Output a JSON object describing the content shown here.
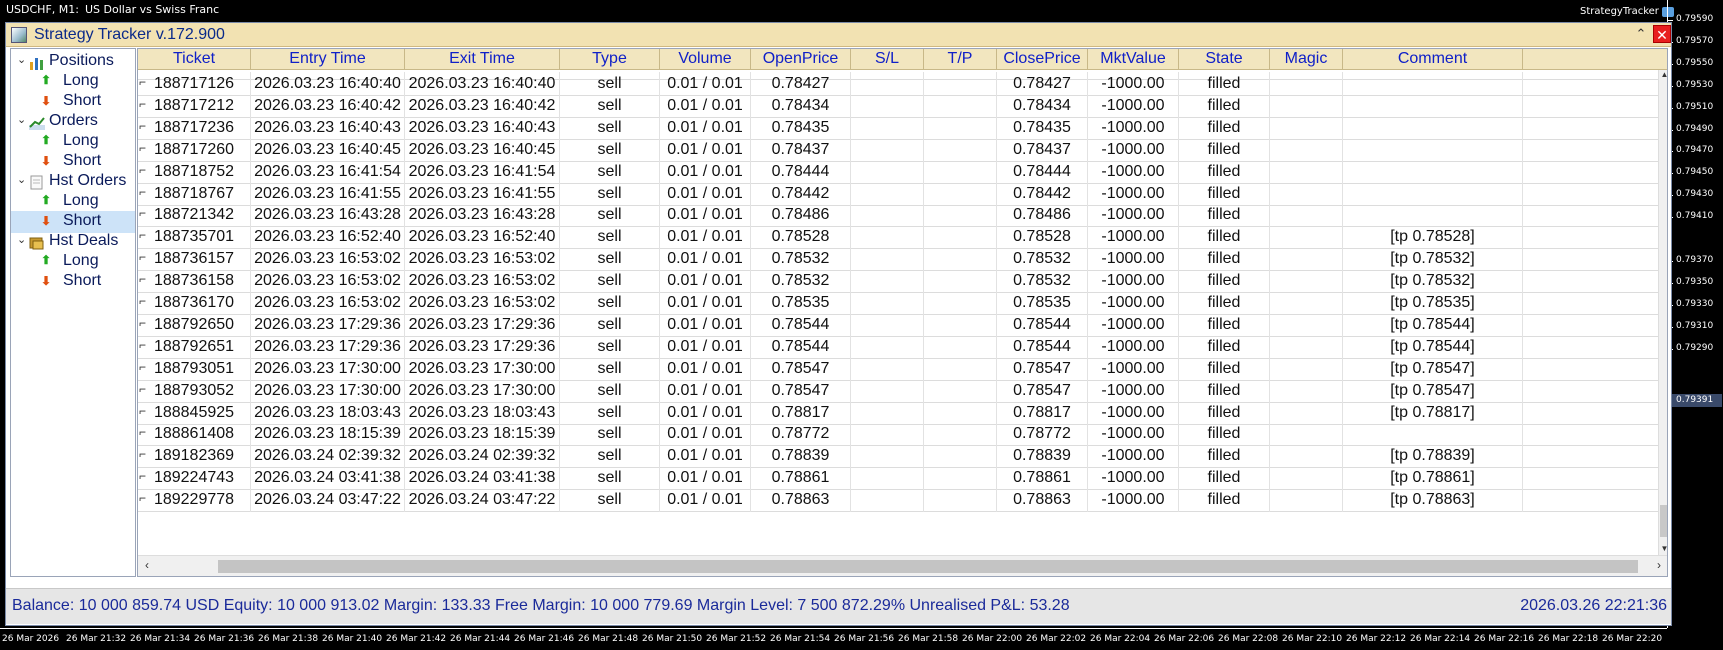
{
  "chart": {
    "symbol": "USDCHF, M1:",
    "description": "US Dollar vs Swiss Franc",
    "badge": "StrategyTracker",
    "price_labels": [
      "0.79590",
      "0.79570",
      "0.79550",
      "0.79530",
      "0.79510",
      "0.79490",
      "0.79470",
      "0.79450",
      "0.79430",
      "0.79410",
      "0.79370",
      "0.79350",
      "0.79330",
      "0.79310",
      "0.79290"
    ],
    "current_price": "0.79391",
    "time_labels": [
      "26 Mar 2026",
      "26 Mar 21:32",
      "26 Mar 21:34",
      "26 Mar 21:36",
      "26 Mar 21:38",
      "26 Mar 21:40",
      "26 Mar 21:42",
      "26 Mar 21:44",
      "26 Mar 21:46",
      "26 Mar 21:48",
      "26 Mar 21:50",
      "26 Mar 21:52",
      "26 Mar 21:54",
      "26 Mar 21:56",
      "26 Mar 21:58",
      "26 Mar 22:00",
      "26 Mar 22:02",
      "26 Mar 22:04",
      "26 Mar 22:06",
      "26 Mar 22:08",
      "26 Mar 22:10",
      "26 Mar 22:12",
      "26 Mar 22:14",
      "26 Mar 22:16",
      "26 Mar 22:18",
      "26 Mar 22:20"
    ]
  },
  "window": {
    "title": "Strategy Tracker v.172.900",
    "collapse_glyph": "⌃",
    "close_glyph": "✕"
  },
  "tree": [
    {
      "label": "Positions",
      "level": 0,
      "icon": "bar-chart-icon",
      "expanded": true
    },
    {
      "label": "Long",
      "level": 1,
      "icon": "arrow-up-icon"
    },
    {
      "label": "Short",
      "level": 1,
      "icon": "arrow-down-icon"
    },
    {
      "label": "Orders",
      "level": 0,
      "icon": "line-chart-icon",
      "expanded": true
    },
    {
      "label": "Long",
      "level": 1,
      "icon": "arrow-up-icon"
    },
    {
      "label": "Short",
      "level": 1,
      "icon": "arrow-down-icon"
    },
    {
      "label": "Hst Orders",
      "level": 0,
      "icon": "document-icon",
      "expanded": true
    },
    {
      "label": "Long",
      "level": 1,
      "icon": "arrow-up-icon"
    },
    {
      "label": "Short",
      "level": 1,
      "icon": "arrow-down-icon",
      "selected": true
    },
    {
      "label": "Hst Deals",
      "level": 0,
      "icon": "coins-icon",
      "expanded": true
    },
    {
      "label": "Long",
      "level": 1,
      "icon": "arrow-up-icon"
    },
    {
      "label": "Short",
      "level": 1,
      "icon": "arrow-down-icon"
    }
  ],
  "columns": [
    "Ticket",
    "Entry Time",
    "Exit Time",
    "Type",
    "Volume",
    "OpenPrice",
    "S/L",
    "T/P",
    "ClosePrice",
    "MktValue",
    "State",
    "Magic",
    "Comment"
  ],
  "rows": [
    [
      "188717126",
      "2026.03.23 16:40:40",
      "2026.03.23 16:40:40",
      "sell",
      "0.01 / 0.01",
      "0.78427",
      "",
      "",
      "0.78427",
      "-1000.00",
      "filled",
      "",
      ""
    ],
    [
      "188717212",
      "2026.03.23 16:40:42",
      "2026.03.23 16:40:42",
      "sell",
      "0.01 / 0.01",
      "0.78434",
      "",
      "",
      "0.78434",
      "-1000.00",
      "filled",
      "",
      ""
    ],
    [
      "188717236",
      "2026.03.23 16:40:43",
      "2026.03.23 16:40:43",
      "sell",
      "0.01 / 0.01",
      "0.78435",
      "",
      "",
      "0.78435",
      "-1000.00",
      "filled",
      "",
      ""
    ],
    [
      "188717260",
      "2026.03.23 16:40:45",
      "2026.03.23 16:40:45",
      "sell",
      "0.01 / 0.01",
      "0.78437",
      "",
      "",
      "0.78437",
      "-1000.00",
      "filled",
      "",
      ""
    ],
    [
      "188718752",
      "2026.03.23 16:41:54",
      "2026.03.23 16:41:54",
      "sell",
      "0.01 / 0.01",
      "0.78444",
      "",
      "",
      "0.78444",
      "-1000.00",
      "filled",
      "",
      ""
    ],
    [
      "188718767",
      "2026.03.23 16:41:55",
      "2026.03.23 16:41:55",
      "sell",
      "0.01 / 0.01",
      "0.78442",
      "",
      "",
      "0.78442",
      "-1000.00",
      "filled",
      "",
      ""
    ],
    [
      "188721342",
      "2026.03.23 16:43:28",
      "2026.03.23 16:43:28",
      "sell",
      "0.01 / 0.01",
      "0.78486",
      "",
      "",
      "0.78486",
      "-1000.00",
      "filled",
      "",
      ""
    ],
    [
      "188735701",
      "2026.03.23 16:52:40",
      "2026.03.23 16:52:40",
      "sell",
      "0.01 / 0.01",
      "0.78528",
      "",
      "",
      "0.78528",
      "-1000.00",
      "filled",
      "",
      "[tp 0.78528]"
    ],
    [
      "188736157",
      "2026.03.23 16:53:02",
      "2026.03.23 16:53:02",
      "sell",
      "0.01 / 0.01",
      "0.78532",
      "",
      "",
      "0.78532",
      "-1000.00",
      "filled",
      "",
      "[tp 0.78532]"
    ],
    [
      "188736158",
      "2026.03.23 16:53:02",
      "2026.03.23 16:53:02",
      "sell",
      "0.01 / 0.01",
      "0.78532",
      "",
      "",
      "0.78532",
      "-1000.00",
      "filled",
      "",
      "[tp 0.78532]"
    ],
    [
      "188736170",
      "2026.03.23 16:53:02",
      "2026.03.23 16:53:02",
      "sell",
      "0.01 / 0.01",
      "0.78535",
      "",
      "",
      "0.78535",
      "-1000.00",
      "filled",
      "",
      "[tp 0.78535]"
    ],
    [
      "188792650",
      "2026.03.23 17:29:36",
      "2026.03.23 17:29:36",
      "sell",
      "0.01 / 0.01",
      "0.78544",
      "",
      "",
      "0.78544",
      "-1000.00",
      "filled",
      "",
      "[tp 0.78544]"
    ],
    [
      "188792651",
      "2026.03.23 17:29:36",
      "2026.03.23 17:29:36",
      "sell",
      "0.01 / 0.01",
      "0.78544",
      "",
      "",
      "0.78544",
      "-1000.00",
      "filled",
      "",
      "[tp 0.78544]"
    ],
    [
      "188793051",
      "2026.03.23 17:30:00",
      "2026.03.23 17:30:00",
      "sell",
      "0.01 / 0.01",
      "0.78547",
      "",
      "",
      "0.78547",
      "-1000.00",
      "filled",
      "",
      "[tp 0.78547]"
    ],
    [
      "188793052",
      "2026.03.23 17:30:00",
      "2026.03.23 17:30:00",
      "sell",
      "0.01 / 0.01",
      "0.78547",
      "",
      "",
      "0.78547",
      "-1000.00",
      "filled",
      "",
      "[tp 0.78547]"
    ],
    [
      "188845925",
      "2026.03.23 18:03:43",
      "2026.03.23 18:03:43",
      "sell",
      "0.01 / 0.01",
      "0.78817",
      "",
      "",
      "0.78817",
      "-1000.00",
      "filled",
      "",
      "[tp 0.78817]"
    ],
    [
      "188861408",
      "2026.03.23 18:15:39",
      "2026.03.23 18:15:39",
      "sell",
      "0.01 / 0.01",
      "0.78772",
      "",
      "",
      "0.78772",
      "-1000.00",
      "filled",
      "",
      ""
    ],
    [
      "189182369",
      "2026.03.24 02:39:32",
      "2026.03.24 02:39:32",
      "sell",
      "0.01 / 0.01",
      "0.78839",
      "",
      "",
      "0.78839",
      "-1000.00",
      "filled",
      "",
      "[tp 0.78839]"
    ],
    [
      "189224743",
      "2026.03.24 03:41:38",
      "2026.03.24 03:41:38",
      "sell",
      "0.01 / 0.01",
      "0.78861",
      "",
      "",
      "0.78861",
      "-1000.00",
      "filled",
      "",
      "[tp 0.78861]"
    ],
    [
      "189229778",
      "2026.03.24 03:47:22",
      "2026.03.24 03:47:22",
      "sell",
      "0.01 / 0.01",
      "0.78863",
      "",
      "",
      "0.78863",
      "-1000.00",
      "filled",
      "",
      "[tp 0.78863]"
    ]
  ],
  "status": {
    "summary": "Balance: 10 000 859.74 USD  Equity: 10 000 913.02  Margin: 133.33  Free Margin: 10 000 779.69  Margin Level: 7 500 872.29%  Unrealised P&L: 53.28",
    "datetime": "2026.03.26 22:21:36"
  },
  "colors": {
    "header_bg": "#f2e6bf",
    "header_text": "#1020c8",
    "status_text": "#1a2a9a",
    "close_button": "#e81e1e"
  }
}
